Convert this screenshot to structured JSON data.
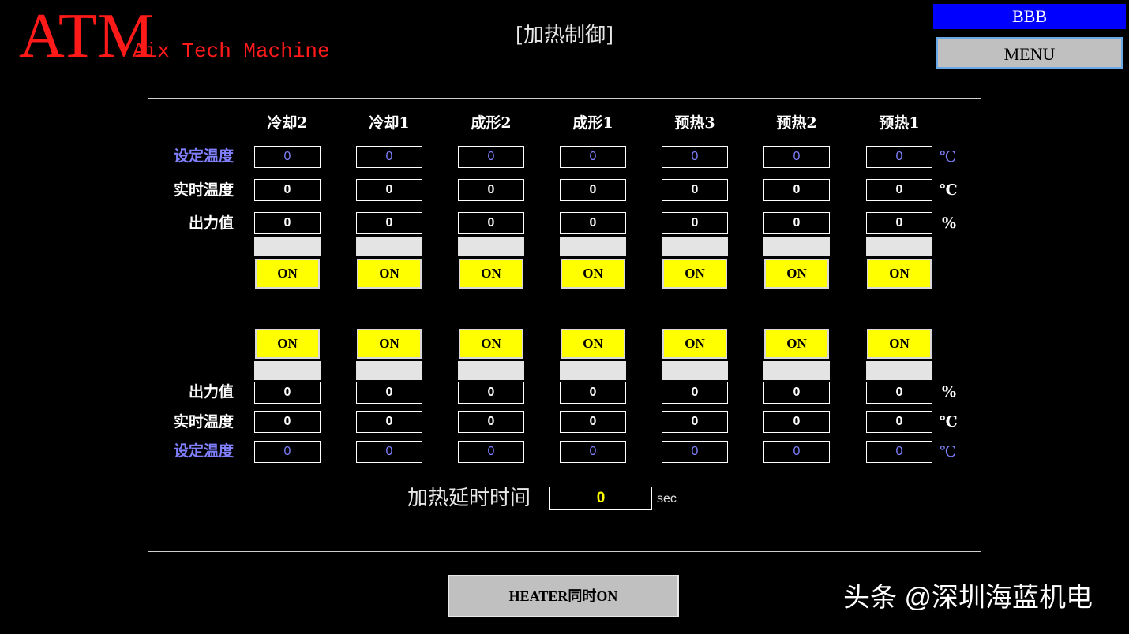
{
  "header": {
    "logo": "ATM",
    "logo_subtitle": "Aix Tech Machine",
    "page_title": "[加热制御]",
    "badge": "BBB",
    "menu_label": "MENU"
  },
  "columns": [
    "冷却2",
    "冷却1",
    "成形2",
    "成形1",
    "预热3",
    "预热2",
    "预热1"
  ],
  "labels": {
    "set_temp": "设定温度",
    "actual_temp": "实时温度",
    "output": "出力值"
  },
  "units": {
    "temp": "℃",
    "percent": "%"
  },
  "upper": {
    "set_temp": [
      "0",
      "0",
      "0",
      "0",
      "0",
      "0",
      "0"
    ],
    "actual_temp": [
      "0",
      "0",
      "0",
      "0",
      "0",
      "0",
      "0"
    ],
    "output": [
      "0",
      "0",
      "0",
      "0",
      "0",
      "0",
      "0"
    ],
    "output_level": [
      0,
      0,
      0,
      0,
      0,
      0,
      0
    ],
    "switch": [
      "ON",
      "ON",
      "ON",
      "ON",
      "ON",
      "ON",
      "ON"
    ]
  },
  "lower": {
    "switch": [
      "ON",
      "ON",
      "ON",
      "ON",
      "ON",
      "ON",
      "ON"
    ],
    "output_level": [
      0,
      0,
      0,
      0,
      0,
      0,
      0
    ],
    "output": [
      "0",
      "0",
      "0",
      "0",
      "0",
      "0",
      "0"
    ],
    "actual_temp": [
      "0",
      "0",
      "0",
      "0",
      "0",
      "0",
      "0"
    ],
    "set_temp": [
      "0",
      "0",
      "0",
      "0",
      "0",
      "0",
      "0"
    ]
  },
  "delay": {
    "label": "加热延时时间",
    "value": "0",
    "unit": "sec"
  },
  "footer": {
    "heater_button": "HEATER同时ON",
    "watermark": "头条 @深圳海蓝机电"
  },
  "colors": {
    "background": "#000000",
    "logo": "#ff1a1a",
    "badge": "#0000ff",
    "switch_on": "#ffff00",
    "set_temp_text": "#8080ff",
    "delay_value": "#ffff00"
  }
}
